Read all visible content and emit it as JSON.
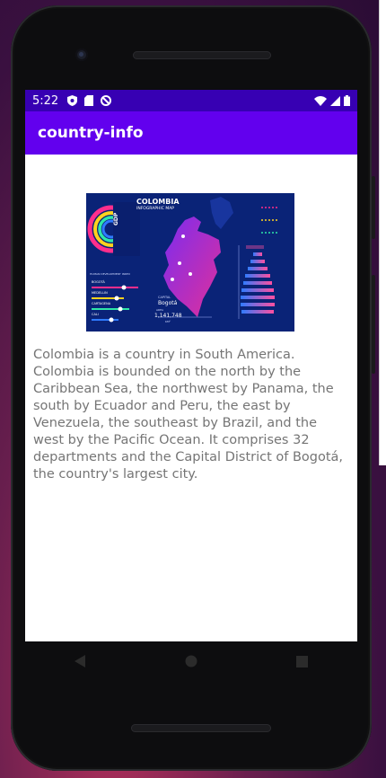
{
  "status_bar": {
    "time": "5:22",
    "left_icons": [
      "shield-icon",
      "sim-card-icon",
      "do-not-disturb-icon"
    ],
    "right_icons": [
      "wifi-icon",
      "signal-icon",
      "battery-icon"
    ]
  },
  "app_bar": {
    "title": "country-info"
  },
  "infographic": {
    "title": "COLOMBIA",
    "subtitle": "INFOGRAPHIC MAP",
    "ring_label": "GDP",
    "cities": [
      "BOGOTÁ",
      "MEDELLIN",
      "CARTAGENA",
      "CALI"
    ],
    "city_bars_title": "HUMAN DEVELOPMENT INDEX",
    "capital_label": "CAPITAL",
    "capital_name": "Bogotá",
    "area_label": "AREA",
    "area_value": "1,141,748",
    "area_unit": "KM²",
    "colors": {
      "background": "#0a1f6e",
      "map_start": "#7b2cf0",
      "map_end": "#e0309a",
      "accent_pink": "#ff2e8c",
      "accent_yellow": "#ffd21e",
      "accent_green": "#2ee6a8",
      "accent_blue": "#2f7bff"
    }
  },
  "description": "Colombia is a country in South America. Colombia is bounded on the north by the Caribbean Sea, the northwest by Panama, the south by Ecuador and Peru, the east by Venezuela, the southeast by Brazil, and the west by the Pacific Ocean. It comprises 32 departments and the Capital District of Bogotá, the country's largest city.",
  "nav_bar": {
    "buttons": [
      "back-icon",
      "home-icon",
      "recents-icon"
    ]
  }
}
